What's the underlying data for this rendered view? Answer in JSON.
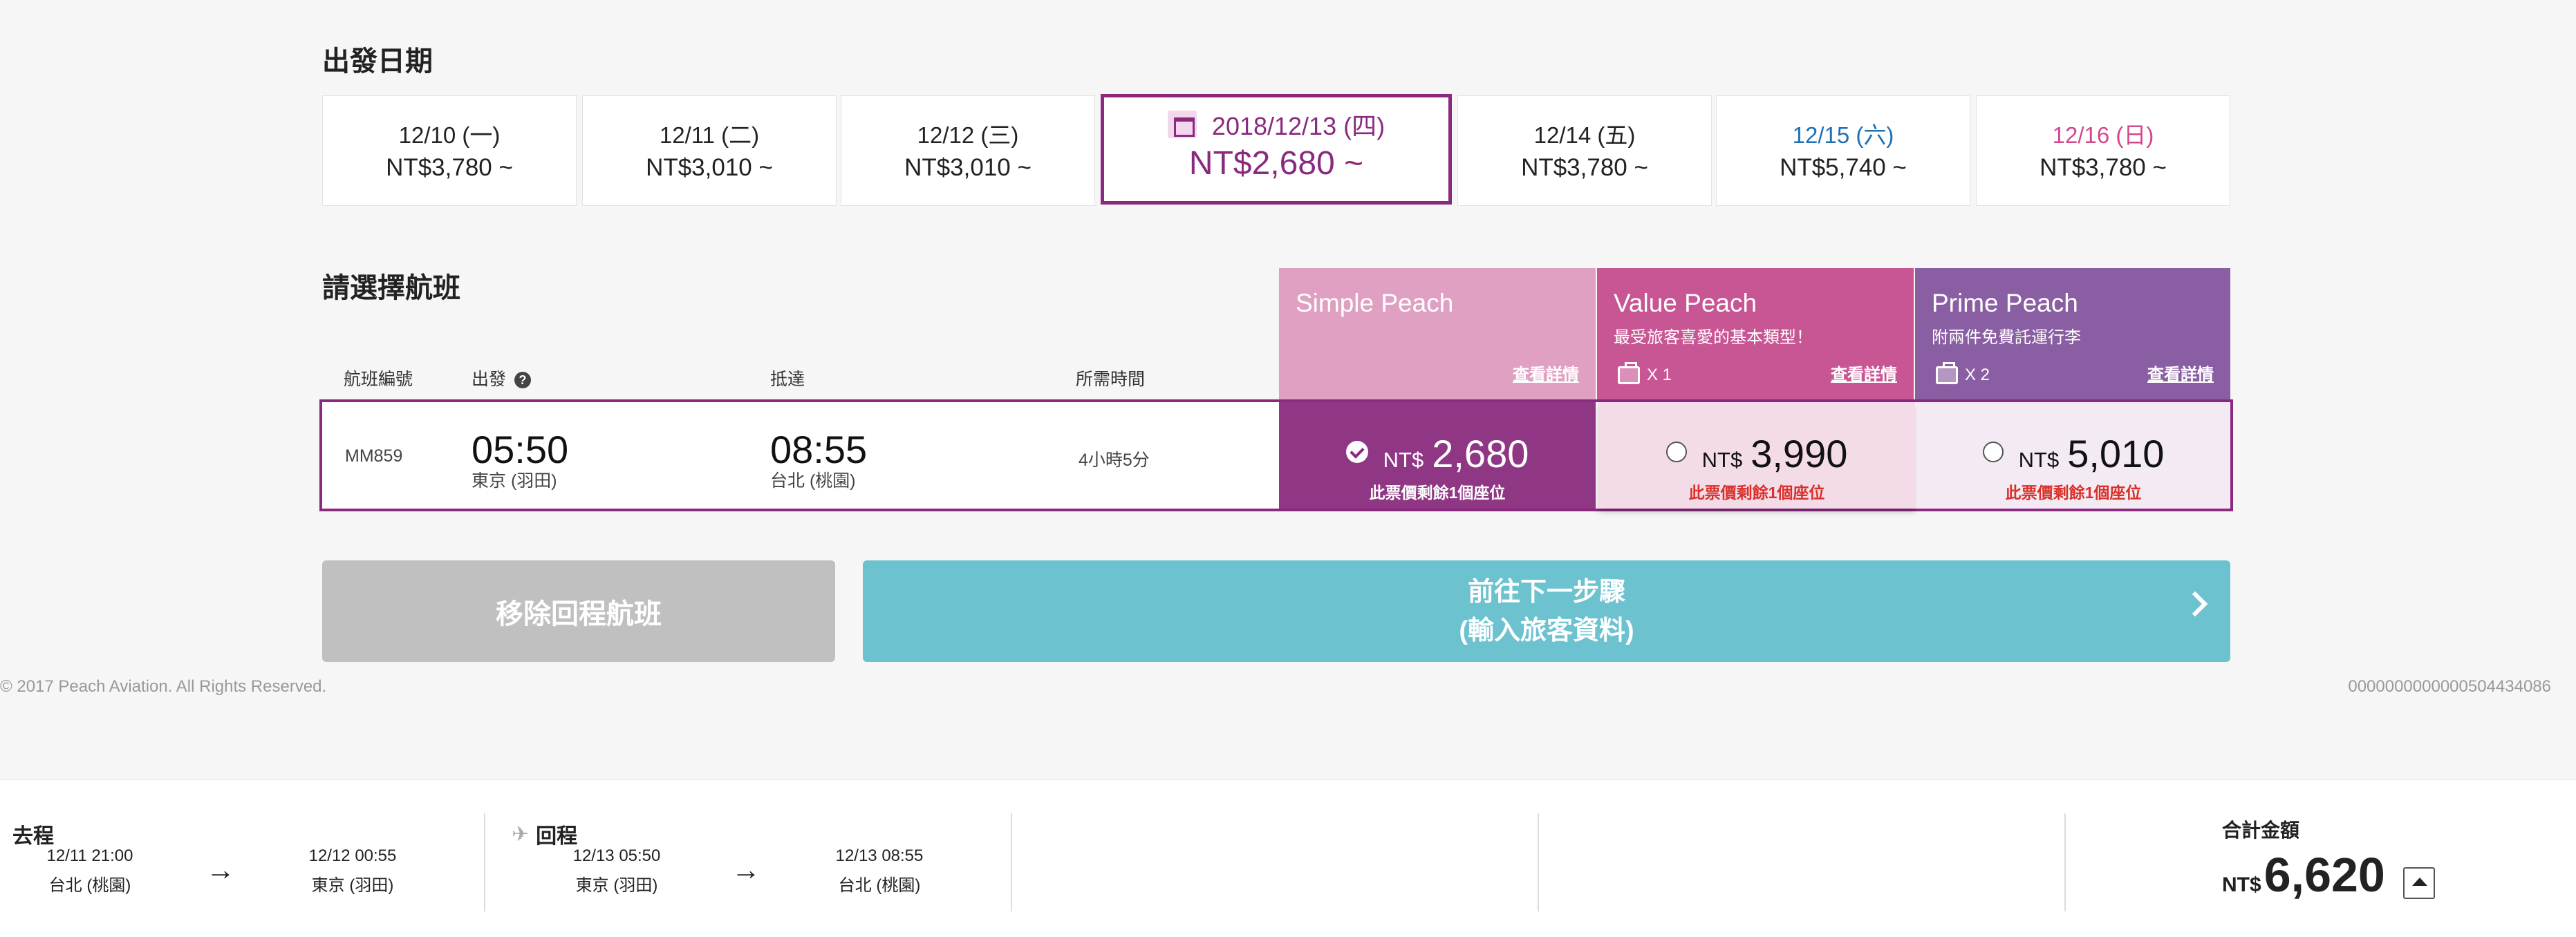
{
  "departure_date": {
    "title": "出發日期",
    "dates": [
      {
        "date": "12/10 (一)",
        "price": "NT$3,780 ~"
      },
      {
        "date": "12/11 (二)",
        "price": "NT$3,010 ~"
      },
      {
        "date": "12/12 (三)",
        "price": "NT$3,010 ~"
      },
      {
        "date": "2018/12/13 (四)",
        "price": "NT$2,680 ~",
        "selected": true
      },
      {
        "date": "12/14 (五)",
        "price": "NT$3,780 ~"
      },
      {
        "date": "12/15 (六)",
        "price": "NT$5,740 ~",
        "color": "#1f6fb5"
      },
      {
        "date": "12/16 (日)",
        "price": "NT$3,780 ~",
        "color": "#d2488d"
      }
    ],
    "selected_color": "#8a2a7f"
  },
  "flight_select": {
    "title": "請選擇航班",
    "columns": {
      "flight_no": "航班編號",
      "departure": "出發",
      "arrival": "抵達",
      "duration": "所需時間"
    },
    "fares": [
      {
        "name": "Simple Peach",
        "subtitle": "",
        "bag": "",
        "link": "查看詳情",
        "color": "#e0a0c2"
      },
      {
        "name": "Value Peach",
        "subtitle": "最受旅客喜愛的基本類型！",
        "bag": "X 1",
        "link": "查看詳情",
        "color": "#c85594"
      },
      {
        "name": "Prime Peach",
        "subtitle": "附兩件免費託運行李",
        "bag": "X 2",
        "link": "查看詳情",
        "color": "#8a5ea2"
      }
    ],
    "flight": {
      "flight_no": "MM859",
      "dep_time": "05:50",
      "dep_airport": "東京 (羽田)",
      "arr_time": "08:55",
      "arr_airport": "台北 (桃園)",
      "duration": "4小時5分",
      "prices": [
        {
          "currency": "NT$",
          "amount": "2,680",
          "remaining": "此票價剩餘1個座位",
          "selected": true
        },
        {
          "currency": "NT$",
          "amount": "3,990",
          "remaining": "此票價剩餘1個座位",
          "selected": false
        },
        {
          "currency": "NT$",
          "amount": "5,010",
          "remaining": "此票價剩餘1個座位",
          "selected": false
        }
      ]
    }
  },
  "buttons": {
    "remove_return": "移除回程航班",
    "next_line1": "前往下一步驟",
    "next_line2": "(輸入旅客資料)"
  },
  "footer": {
    "copyright": "© 2017 Peach Aviation. All Rights Reserved.",
    "code": "0000000000000504434086"
  },
  "summary": {
    "outbound": {
      "label": "去程",
      "dep_time": "12/11 21:00",
      "dep_airport": "台北 (桃園)",
      "arr_time": "12/12 00:55",
      "arr_airport": "東京 (羽田)"
    },
    "inbound": {
      "label": "回程",
      "dep_time": "12/13 05:50",
      "dep_airport": "東京 (羽田)",
      "arr_time": "12/13 08:55",
      "arr_airport": "台北 (桃園)"
    },
    "total_label": "合計金額",
    "total_currency": "NT$",
    "total_amount": "6,620"
  }
}
